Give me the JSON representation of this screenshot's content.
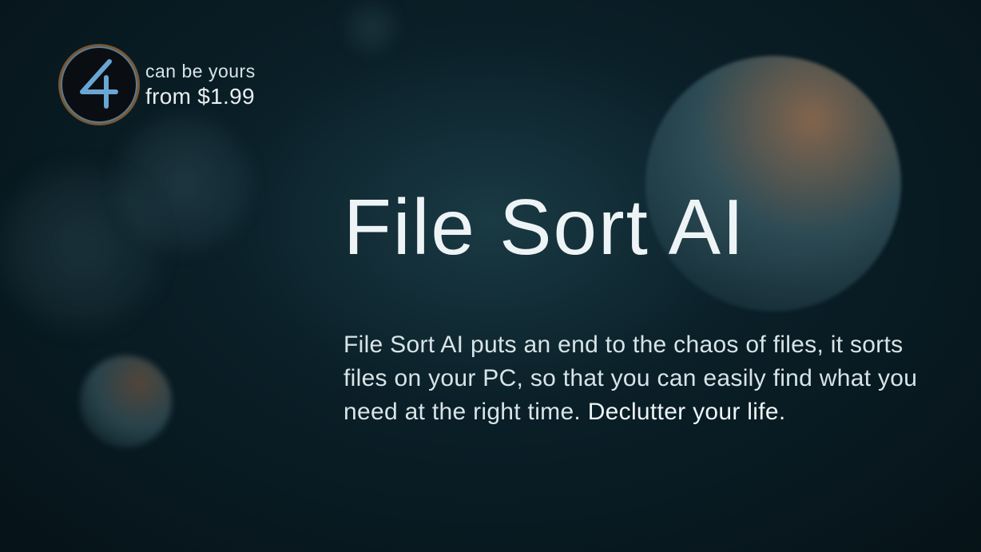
{
  "badge": {
    "line1": "can be yours",
    "line2": "from $1.99",
    "logo_glyph": "4"
  },
  "main": {
    "title": "File Sort AI",
    "description_part1": "File Sort AI puts an end to the chaos of files, it sorts files on your PC, so that you can easily find what you need at the right time. ",
    "description_emphasis": "Declutter your life."
  },
  "colors": {
    "text_primary": "#eef4f6",
    "text_secondary": "#d8e4e7",
    "accent_blue": "#6aa6d4",
    "accent_orange": "#d28c46",
    "bg_dark": "#061318"
  }
}
